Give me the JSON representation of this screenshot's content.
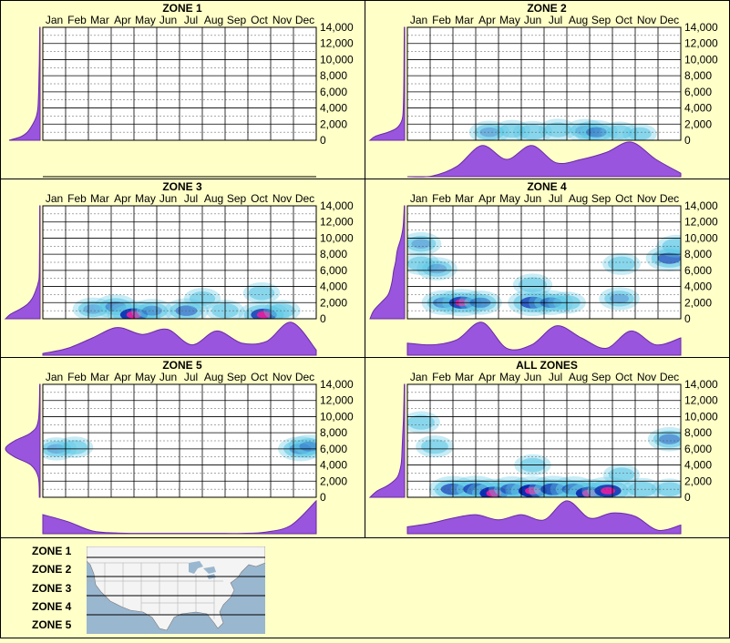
{
  "months": [
    "Jan",
    "Feb",
    "Mar",
    "Apr",
    "May",
    "Jun",
    "Jul",
    "Aug",
    "Sep",
    "Oct",
    "Nov",
    "Dec"
  ],
  "y_ticks": [
    "14,000",
    "12,000",
    "10,000",
    "8,000",
    "6,000",
    "4,000",
    "2,000",
    "0"
  ],
  "colors": {
    "background": "#ffffc8",
    "profile_fill": "#9955dd",
    "profile_stroke": "#6a2aa8",
    "density_low": "#5ec8e6",
    "density_mid": "#0a2ab0",
    "density_high": "#e020a0",
    "map_water": "#9ab7d0",
    "map_land": "#f4f4f4"
  },
  "chart_data": [
    {
      "type": "heatmap",
      "title": "ZONE 1",
      "x_categories": [
        "Jan",
        "Feb",
        "Mar",
        "Apr",
        "May",
        "Jun",
        "Jul",
        "Aug",
        "Sep",
        "Oct",
        "Nov",
        "Dec"
      ],
      "ylim": [
        0,
        14000
      ],
      "hotspots": [],
      "monthly_profile": [
        0,
        0,
        0,
        0,
        0,
        0,
        0,
        0,
        0,
        0,
        0,
        0
      ],
      "elevation_profile": [
        {
          "elev": 0,
          "w": 0.85
        },
        {
          "elev": 400,
          "w": 0.55
        },
        {
          "elev": 1000,
          "w": 0.35
        },
        {
          "elev": 2000,
          "w": 0.2
        },
        {
          "elev": 3000,
          "w": 0.1
        },
        {
          "elev": 4000,
          "w": 0.06
        },
        {
          "elev": 6000,
          "w": 0.04
        },
        {
          "elev": 8000,
          "w": 0.03
        },
        {
          "elev": 10000,
          "w": 0.02
        },
        {
          "elev": 14000,
          "w": 0.01
        }
      ]
    },
    {
      "type": "heatmap",
      "title": "ZONE 2",
      "x_categories": [
        "Jan",
        "Feb",
        "Mar",
        "Apr",
        "May",
        "Jun",
        "Jul",
        "Aug",
        "Sep",
        "Oct",
        "Nov",
        "Dec"
      ],
      "ylim": [
        0,
        14000
      ],
      "hotspots": [
        {
          "month": 3.6,
          "elev": 1000,
          "i": 0.45
        },
        {
          "month": 4.6,
          "elev": 1200,
          "i": 0.3
        },
        {
          "month": 5.5,
          "elev": 1000,
          "i": 0.4
        },
        {
          "month": 6.6,
          "elev": 1300,
          "i": 0.35
        },
        {
          "month": 7.8,
          "elev": 1200,
          "i": 0.45
        },
        {
          "month": 8.3,
          "elev": 1000,
          "i": 0.55
        },
        {
          "month": 9.3,
          "elev": 1000,
          "i": 0.3
        },
        {
          "month": 10.2,
          "elev": 800,
          "i": 0.2
        }
      ],
      "monthly_profile": [
        0,
        0.02,
        0.3,
        0.9,
        0.5,
        0.9,
        0.4,
        0.5,
        0.7,
        1.0,
        0.5,
        0.1
      ],
      "elevation_profile": [
        {
          "elev": 0,
          "w": 0.95
        },
        {
          "elev": 500,
          "w": 0.8
        },
        {
          "elev": 1000,
          "w": 0.45
        },
        {
          "elev": 1500,
          "w": 0.22
        },
        {
          "elev": 2200,
          "w": 0.1
        },
        {
          "elev": 3000,
          "w": 0.05
        },
        {
          "elev": 5000,
          "w": 0.03
        },
        {
          "elev": 8000,
          "w": 0.02
        },
        {
          "elev": 14000,
          "w": 0.01
        }
      ]
    },
    {
      "type": "heatmap",
      "title": "ZONE 3",
      "x_categories": [
        "Jan",
        "Feb",
        "Mar",
        "Apr",
        "May",
        "Jun",
        "Jul",
        "Aug",
        "Sep",
        "Oct",
        "Nov",
        "Dec"
      ],
      "ylim": [
        0,
        14000
      ],
      "hotspots": [
        {
          "month": 2.2,
          "elev": 1200,
          "i": 0.45
        },
        {
          "month": 3.2,
          "elev": 1500,
          "i": 0.55
        },
        {
          "month": 4.0,
          "elev": 500,
          "i": 0.95
        },
        {
          "month": 4.8,
          "elev": 1000,
          "i": 0.5
        },
        {
          "month": 6.3,
          "elev": 1000,
          "i": 0.6
        },
        {
          "month": 7.0,
          "elev": 2500,
          "i": 0.3
        },
        {
          "month": 8.0,
          "elev": 1000,
          "i": 0.35
        },
        {
          "month": 9.6,
          "elev": 3200,
          "i": 0.3
        },
        {
          "month": 9.7,
          "elev": 500,
          "i": 0.85
        },
        {
          "month": 10.5,
          "elev": 1000,
          "i": 0.3
        }
      ],
      "monthly_profile": [
        0.05,
        0.2,
        0.5,
        0.8,
        0.6,
        0.75,
        0.3,
        0.7,
        0.35,
        0.4,
        0.95,
        0.15
      ],
      "elevation_profile": [
        {
          "elev": 0,
          "w": 0.95
        },
        {
          "elev": 600,
          "w": 0.8
        },
        {
          "elev": 1200,
          "w": 0.55
        },
        {
          "elev": 1800,
          "w": 0.35
        },
        {
          "elev": 2500,
          "w": 0.22
        },
        {
          "elev": 3500,
          "w": 0.12
        },
        {
          "elev": 4500,
          "w": 0.05
        },
        {
          "elev": 6000,
          "w": 0.02
        },
        {
          "elev": 14000,
          "w": 0.01
        }
      ]
    },
    {
      "type": "heatmap",
      "title": "ZONE 4",
      "x_categories": [
        "Jan",
        "Feb",
        "Mar",
        "Apr",
        "May",
        "Jun",
        "Jul",
        "Aug",
        "Sep",
        "Oct",
        "Nov",
        "Dec"
      ],
      "ylim": [
        0,
        14000
      ],
      "hotspots": [
        {
          "month": 0.6,
          "elev": 9300,
          "i": 0.45
        },
        {
          "month": 0.6,
          "elev": 6800,
          "i": 0.35
        },
        {
          "month": 1.3,
          "elev": 6200,
          "i": 0.45
        },
        {
          "month": 1.6,
          "elev": 2000,
          "i": 0.6
        },
        {
          "month": 2.4,
          "elev": 2000,
          "i": 0.85
        },
        {
          "month": 3.2,
          "elev": 2000,
          "i": 0.55
        },
        {
          "month": 5.5,
          "elev": 4200,
          "i": 0.4
        },
        {
          "month": 5.5,
          "elev": 2000,
          "i": 0.8
        },
        {
          "month": 6.3,
          "elev": 2000,
          "i": 0.6
        },
        {
          "month": 7.0,
          "elev": 2000,
          "i": 0.35
        },
        {
          "month": 9.4,
          "elev": 6800,
          "i": 0.35
        },
        {
          "month": 9.3,
          "elev": 2500,
          "i": 0.45
        },
        {
          "month": 11.5,
          "elev": 7500,
          "i": 0.7
        },
        {
          "month": 11.8,
          "elev": 9000,
          "i": 0.4
        }
      ],
      "monthly_profile": [
        0.35,
        0.3,
        0.45,
        0.95,
        0.2,
        0.3,
        0.85,
        0.5,
        0.2,
        0.7,
        0.3,
        0.5
      ],
      "elevation_profile": [
        {
          "elev": 0,
          "w": 0.95
        },
        {
          "elev": 1000,
          "w": 0.85
        },
        {
          "elev": 2000,
          "w": 0.65
        },
        {
          "elev": 3000,
          "w": 0.45
        },
        {
          "elev": 4500,
          "w": 0.35
        },
        {
          "elev": 6000,
          "w": 0.3
        },
        {
          "elev": 7000,
          "w": 0.25
        },
        {
          "elev": 8500,
          "w": 0.2
        },
        {
          "elev": 10000,
          "w": 0.1
        },
        {
          "elev": 11500,
          "w": 0.04
        },
        {
          "elev": 14000,
          "w": 0.01
        }
      ]
    },
    {
      "type": "heatmap",
      "title": "ZONE 5",
      "x_categories": [
        "Jan",
        "Feb",
        "Mar",
        "Apr",
        "May",
        "Jun",
        "Jul",
        "Aug",
        "Sep",
        "Oct",
        "Nov",
        "Dec"
      ],
      "ylim": [
        0,
        14000
      ],
      "hotspots": [
        {
          "month": 0.6,
          "elev": 6000,
          "i": 0.45
        },
        {
          "month": 1.4,
          "elev": 6200,
          "i": 0.3
        },
        {
          "month": 11.3,
          "elev": 6000,
          "i": 0.6
        },
        {
          "month": 11.7,
          "elev": 6300,
          "i": 0.5
        }
      ],
      "monthly_profile": [
        0.55,
        0.35,
        0.08,
        0.02,
        0.01,
        0.01,
        0.01,
        0.01,
        0.01,
        0.05,
        0.25,
        0.95
      ],
      "elevation_profile": [
        {
          "elev": 0,
          "w": 0.02
        },
        {
          "elev": 2500,
          "w": 0.05
        },
        {
          "elev": 4000,
          "w": 0.25
        },
        {
          "elev": 5000,
          "w": 0.7
        },
        {
          "elev": 6000,
          "w": 0.95
        },
        {
          "elev": 7000,
          "w": 0.7
        },
        {
          "elev": 8000,
          "w": 0.25
        },
        {
          "elev": 9500,
          "w": 0.05
        },
        {
          "elev": 14000,
          "w": 0.01
        }
      ]
    },
    {
      "type": "heatmap",
      "title": "ALL ZONES",
      "x_categories": [
        "Jan",
        "Feb",
        "Mar",
        "Apr",
        "May",
        "Jun",
        "Jul",
        "Aug",
        "Sep",
        "Oct",
        "Nov",
        "Dec"
      ],
      "ylim": [
        0,
        14000
      ],
      "hotspots": [
        {
          "month": 0.6,
          "elev": 9300,
          "i": 0.35
        },
        {
          "month": 1.2,
          "elev": 6300,
          "i": 0.35
        },
        {
          "month": 2.0,
          "elev": 1000,
          "i": 0.75
        },
        {
          "month": 3.0,
          "elev": 1000,
          "i": 0.8
        },
        {
          "month": 3.8,
          "elev": 500,
          "i": 1.0
        },
        {
          "month": 4.6,
          "elev": 1000,
          "i": 0.7
        },
        {
          "month": 5.5,
          "elev": 800,
          "i": 1.0
        },
        {
          "month": 5.5,
          "elev": 4000,
          "i": 0.3
        },
        {
          "month": 6.4,
          "elev": 1000,
          "i": 0.8
        },
        {
          "month": 7.3,
          "elev": 1000,
          "i": 0.7
        },
        {
          "month": 8.0,
          "elev": 500,
          "i": 0.95
        },
        {
          "month": 8.8,
          "elev": 800,
          "i": 0.9
        },
        {
          "month": 9.4,
          "elev": 2800,
          "i": 0.3
        },
        {
          "month": 10.3,
          "elev": 1000,
          "i": 0.4
        },
        {
          "month": 11.5,
          "elev": 7200,
          "i": 0.55
        },
        {
          "month": 11.5,
          "elev": 1000,
          "i": 0.3
        }
      ],
      "monthly_profile": [
        0.2,
        0.3,
        0.45,
        0.55,
        0.4,
        0.55,
        0.4,
        0.95,
        0.45,
        0.6,
        0.5,
        0.1,
        0.25
      ],
      "elevation_profile": [
        {
          "elev": 0,
          "w": 0.95
        },
        {
          "elev": 800,
          "w": 0.75
        },
        {
          "elev": 1500,
          "w": 0.45
        },
        {
          "elev": 2500,
          "w": 0.2
        },
        {
          "elev": 4000,
          "w": 0.1
        },
        {
          "elev": 6000,
          "w": 0.07
        },
        {
          "elev": 8000,
          "w": 0.05
        },
        {
          "elev": 10000,
          "w": 0.03
        },
        {
          "elev": 14000,
          "w": 0.01
        }
      ]
    }
  ],
  "legend": {
    "zones": [
      "ZONE 1",
      "ZONE 2",
      "ZONE 3",
      "ZONE 4",
      "ZONE 5"
    ]
  }
}
